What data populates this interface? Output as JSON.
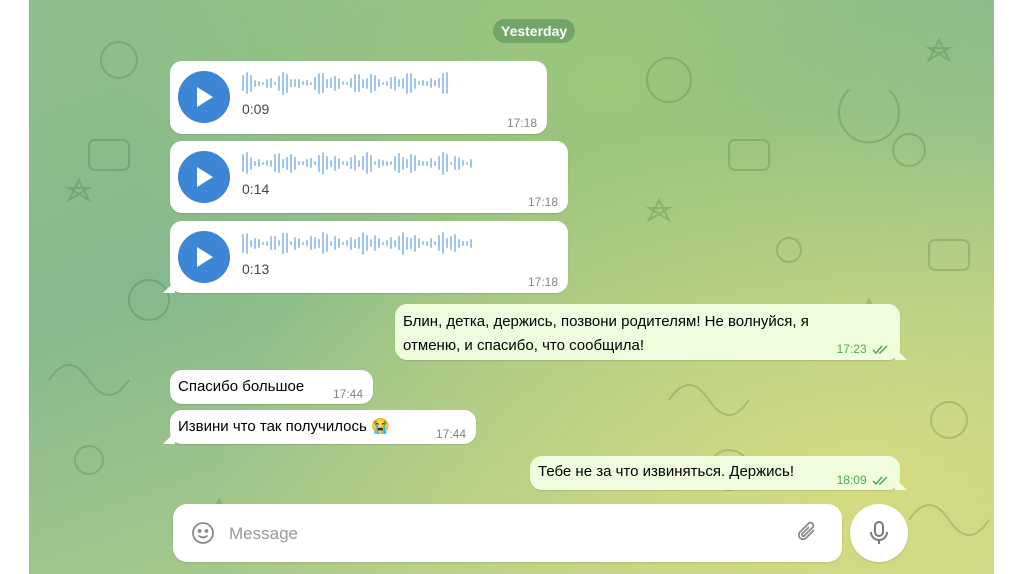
{
  "date_separator": "Yesterday",
  "voice_messages": [
    {
      "duration": "0:09",
      "time": "17:18"
    },
    {
      "duration": "0:14",
      "time": "17:18"
    },
    {
      "duration": "0:13",
      "time": "17:18"
    }
  ],
  "text_messages": [
    {
      "direction": "out",
      "lines": [
        "Блин, детка, держись, позвони родителям! Не волнуйся, я",
        "отменю, и спасибо, что сообщила!"
      ],
      "time": "17:23"
    },
    {
      "direction": "in",
      "text": "Спасибо большое",
      "time": "17:44"
    },
    {
      "direction": "in",
      "text": "Извини что так получилось",
      "emoji": "😭",
      "time": "17:44"
    },
    {
      "direction": "out",
      "text": "Тебе не за что извиняться. Держись!",
      "time": "18:09"
    }
  ],
  "composer": {
    "placeholder": "Message"
  },
  "icons": {
    "play": "play-icon",
    "read_receipt": "double-check-icon",
    "emoji": "smiley-icon",
    "attach": "paperclip-icon",
    "mic": "microphone-icon"
  },
  "colors": {
    "accent": "#3d86d6",
    "outgoing_bubble": "#effdde",
    "incoming_bubble": "#ffffff",
    "outgoing_time": "#4eaa51"
  }
}
